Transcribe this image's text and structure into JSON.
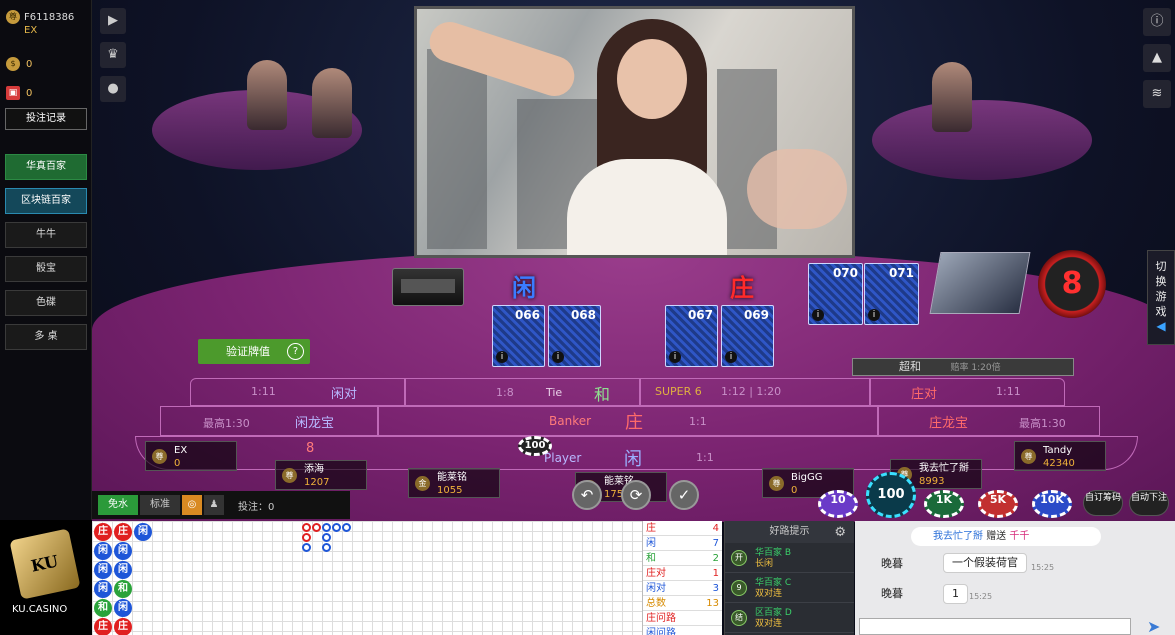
{
  "account": {
    "id": "F6118386",
    "level": "EX",
    "balance": "0",
    "gift": "0",
    "history_button": "投注记录"
  },
  "games": [
    "华真百家",
    "区块链百家",
    "牛牛",
    "骰宝",
    "色碟",
    "多  桌"
  ],
  "right_tab": "切换游戏",
  "labels": {
    "player": "闲",
    "banker": "庄"
  },
  "cards": {
    "player": [
      "066",
      "068"
    ],
    "banker": [
      "067",
      "069"
    ],
    "extra": [
      "070",
      "071"
    ]
  },
  "timer": "8",
  "verify_button": "验证牌值",
  "super_tag": {
    "label": "超和",
    "sub": "赔率 1:20倍"
  },
  "zones": {
    "player_pair": {
      "odds": "1:11",
      "label": "闲对"
    },
    "tie": {
      "odds": "1:8",
      "en": "Tie",
      "label": "和"
    },
    "super6": {
      "en": "SUPER 6",
      "odds": "1:12 | 1:20"
    },
    "banker_pair": {
      "label": "庄对",
      "odds": "1:11"
    },
    "player_dragon": {
      "odds": "最高1:30",
      "label": "闲龙宝"
    },
    "banker_dragon": {
      "label": "庄龙宝",
      "odds": "最高1:30"
    },
    "banker": {
      "en": "Banker",
      "label": "庄",
      "odds": "1:1"
    },
    "player": {
      "en": "Player",
      "label": "闲",
      "odds": "1:1"
    },
    "player_dragon_score": "8"
  },
  "seats": [
    {
      "name": "EX",
      "amount": "0"
    },
    {
      "name": "添海",
      "amount": "1207"
    },
    {
      "name": "能莱铭",
      "amount": "1055"
    },
    {
      "name": "能莱铭",
      "amount": "1750"
    },
    {
      "name": "BigGG",
      "amount": "0"
    },
    {
      "name": "我去忙了掰",
      "amount": "8993"
    },
    {
      "name": "Tandy",
      "amount": "42340"
    }
  ],
  "chips": [
    "10",
    "100",
    "1K",
    "5K",
    "10K"
  ],
  "table_chip": "100",
  "auto_buttons": {
    "custom": "自订筹码",
    "auto": "自动下注"
  },
  "modes": {
    "free": "免水",
    "standard": "标准"
  },
  "bet_label": "投注：0",
  "bead_road": [
    [
      "庄",
      "庄",
      "闲"
    ],
    [
      "闲",
      "闲"
    ],
    [
      "闲",
      "闲"
    ],
    [
      "闲",
      "和"
    ],
    [
      "和",
      "闲"
    ],
    [
      "庄",
      "庄"
    ]
  ],
  "stats": [
    {
      "label": "庄",
      "value": "4"
    },
    {
      "label": "闲",
      "value": "7"
    },
    {
      "label": "和",
      "value": "2"
    },
    {
      "label": "庄对",
      "value": "1"
    },
    {
      "label": "闲对",
      "value": "3"
    },
    {
      "label": "总数",
      "value": "13"
    },
    {
      "label": "庄问路",
      "value": ""
    },
    {
      "label": "闲问路",
      "value": ""
    }
  ],
  "tips": {
    "header": "好路提示",
    "items": [
      {
        "code": "开",
        "name": "华百家 B",
        "tag": "长闲"
      },
      {
        "code": "9",
        "name": "华百家 C",
        "tag": "双对连"
      },
      {
        "code": "结",
        "name": "区百家 D",
        "tag": "双对连"
      }
    ]
  },
  "chat": {
    "gift_user": "我去忙了掰",
    "gift_verb": "赠送",
    "gift_target": "千千",
    "messages": [
      {
        "user": "晚暮",
        "text": "一个假装荷官",
        "time": "15:25"
      },
      {
        "user": "晚暮",
        "text": "1",
        "time": "15:25"
      }
    ]
  },
  "brand": "KU.CASINO",
  "colors": {
    "banker": "#e02020",
    "player": "#1e56d8",
    "tie": "#2aa33a",
    "felt": "#7a2370"
  }
}
